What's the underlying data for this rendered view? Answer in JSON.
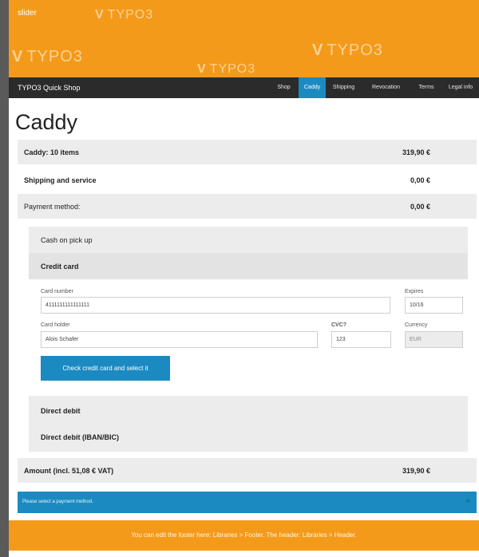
{
  "slider": {
    "label": "slider",
    "watermark": "TYPO3"
  },
  "navbar": {
    "brand": "TYPO3 Quick Shop",
    "items": [
      {
        "label": "Shop",
        "active": false
      },
      {
        "label": "Caddy",
        "active": true
      },
      {
        "label": "Shipping",
        "active": false
      },
      {
        "label": "Revocation",
        "active": false
      },
      {
        "label": "Terms",
        "active": false
      },
      {
        "label": "Legal info",
        "active": false
      }
    ]
  },
  "page": {
    "title": "Caddy"
  },
  "summary": {
    "caddy_label": "Caddy: 10 items",
    "caddy_value": "319,90 €",
    "shipping_label": "Shipping and service",
    "shipping_value": "0,00 €",
    "payment_label": "Payment method:",
    "payment_value": "0,00 €"
  },
  "payment_methods": {
    "cash": "Cash on pick up",
    "credit": "Credit card",
    "direct_debit": "Direct debit",
    "direct_debit_iban": "Direct debit (IBAN/BIC)"
  },
  "credit_form": {
    "card_number_label": "Card number",
    "card_number_value": "4111111111111111",
    "expires_label": "Expires",
    "expires_value": "10/16",
    "holder_label": "Card holder",
    "holder_value": "Alois Schafer",
    "cvc_label": "CVC?",
    "cvc_value": "123",
    "currency_label": "Currency",
    "currency_value": "EUR",
    "submit_label": "Check credit card and select it"
  },
  "amount": {
    "label": "Amount (incl. 51,08 € VAT)",
    "value": "319,90 €"
  },
  "alert": {
    "message": "Please select a payment method.",
    "close": "×"
  },
  "footer": {
    "text": "You can edit the footer here: Libraries > Footer. The header: Libraries > Header."
  },
  "colors": {
    "accent_orange": "#f49a1a",
    "accent_blue": "#1b8ac0",
    "navbar": "#2b2b2b"
  }
}
